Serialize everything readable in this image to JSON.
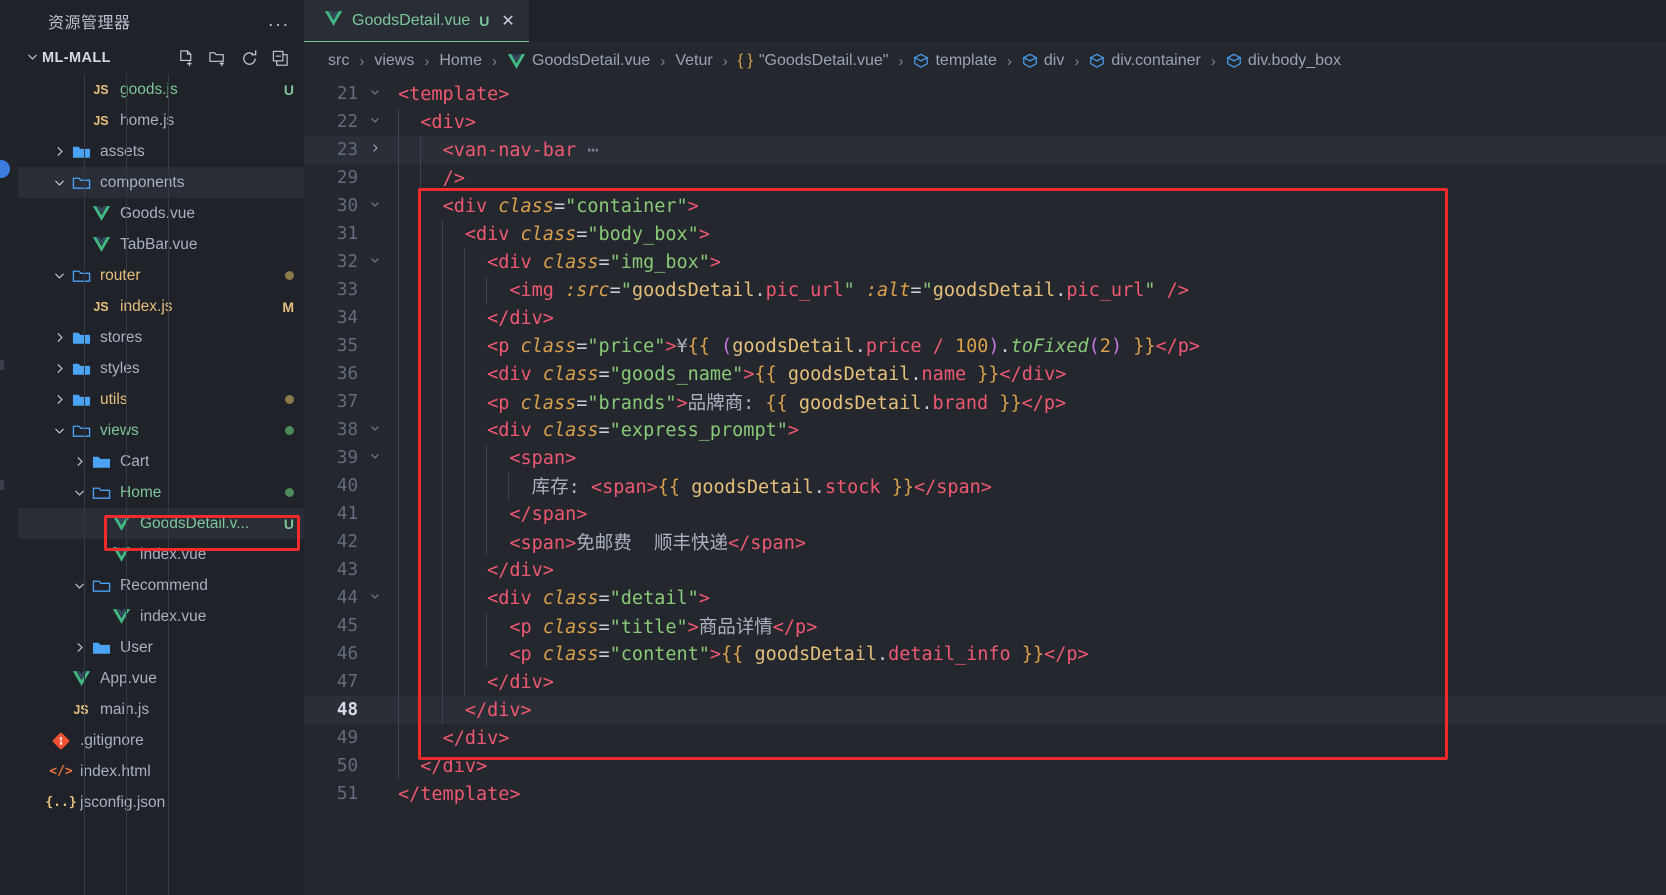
{
  "window": {
    "background": "#24272e",
    "accent_red": "#f02b2b"
  },
  "activity_bar": {
    "badge_name": "notification-badge",
    "badge_color": "#3b7ddd"
  },
  "sidebar": {
    "header_title": "资源管理器",
    "more_actions_label": "...",
    "root": {
      "label": "ML-MALL",
      "expanded": true,
      "actions": [
        {
          "name": "new-file-icon",
          "label": "New File"
        },
        {
          "name": "new-folder-icon",
          "label": "New Folder"
        },
        {
          "name": "refresh-icon",
          "label": "Refresh Explorer"
        },
        {
          "name": "collapse-all-icon",
          "label": "Collapse Folders in Explorer"
        }
      ]
    },
    "items": [
      {
        "label": "goods.js",
        "kind": "js",
        "depth": 3,
        "badge": "U",
        "badge_color": "#7ec699",
        "name_color": "#7ec699",
        "selected": false
      },
      {
        "label": "home.js",
        "kind": "js",
        "depth": 3,
        "badge": "",
        "name_color": "#a8b1c0",
        "selected": false
      },
      {
        "label": "assets",
        "kind": "folder",
        "depth": 2,
        "expanded": false,
        "name_color": "#a8b1c0",
        "selected": false
      },
      {
        "label": "components",
        "kind": "folder",
        "depth": 2,
        "expanded": true,
        "name_color": "#a8b1c0",
        "selected": true
      },
      {
        "label": "Goods.vue",
        "kind": "vue",
        "depth": 3,
        "name_color": "#a8b1c0",
        "selected": false
      },
      {
        "label": "TabBar.vue",
        "kind": "vue",
        "depth": 3,
        "name_color": "#a8b1c0",
        "selected": false
      },
      {
        "label": "router",
        "kind": "folder",
        "depth": 2,
        "expanded": true,
        "name_color": "#e8c07d",
        "dot": "#8a7a4d",
        "selected": false
      },
      {
        "label": "index.js",
        "kind": "js",
        "depth": 3,
        "badge": "M",
        "badge_color": "#e8c07d",
        "name_color": "#e8c07d",
        "selected": false
      },
      {
        "label": "stores",
        "kind": "folder",
        "depth": 2,
        "expanded": false,
        "name_color": "#a8b1c0",
        "selected": false
      },
      {
        "label": "styles",
        "kind": "folder",
        "depth": 2,
        "expanded": false,
        "name_color": "#a8b1c0",
        "selected": false
      },
      {
        "label": "utils",
        "kind": "folder",
        "depth": 2,
        "expanded": false,
        "name_color": "#e8c07d",
        "dot": "#8a7a4d",
        "selected": false
      },
      {
        "label": "views",
        "kind": "folder",
        "depth": 2,
        "expanded": true,
        "name_color": "#7ec699",
        "dot": "#4b8a5a",
        "selected": false
      },
      {
        "label": "Cart",
        "kind": "folder",
        "depth": 3,
        "expanded": false,
        "name_color": "#a8b1c0",
        "selected": false
      },
      {
        "label": "Home",
        "kind": "folder",
        "depth": 3,
        "expanded": true,
        "name_color": "#7ec699",
        "dot": "#4b8a5a",
        "selected": false
      },
      {
        "label": "GoodsDetail.v...",
        "kind": "vue",
        "depth": 4,
        "badge": "U",
        "badge_color": "#7ec699",
        "name_color": "#7ec699",
        "selected": true,
        "annotated": true
      },
      {
        "label": "index.vue",
        "kind": "vue",
        "depth": 4,
        "name_color": "#a8b1c0",
        "selected": false
      },
      {
        "label": "Recommend",
        "kind": "folder",
        "depth": 3,
        "expanded": true,
        "name_color": "#a8b1c0",
        "selected": false
      },
      {
        "label": "index.vue",
        "kind": "vue",
        "depth": 4,
        "name_color": "#a8b1c0",
        "selected": false
      },
      {
        "label": "User",
        "kind": "folder",
        "depth": 3,
        "expanded": false,
        "name_color": "#a8b1c0",
        "selected": false
      },
      {
        "label": "App.vue",
        "kind": "vue",
        "depth": 2,
        "name_color": "#a8b1c0",
        "selected": false
      },
      {
        "label": "main.js",
        "kind": "js",
        "depth": 2,
        "name_color": "#a8b1c0",
        "selected": false
      },
      {
        "label": ".gitignore",
        "kind": "git",
        "depth": 1,
        "name_color": "#a8b1c0",
        "selected": false
      },
      {
        "label": "index.html",
        "kind": "html",
        "depth": 1,
        "name_color": "#a8b1c0",
        "selected": false
      },
      {
        "label": "jsconfig.json",
        "kind": "json",
        "depth": 1,
        "name_color": "#a8b1c0",
        "selected": false
      }
    ]
  },
  "tabs": [
    {
      "name": "GoodsDetail.vue",
      "status": "U",
      "icon": "vue-icon",
      "active": true,
      "close_label": "✕"
    }
  ],
  "breadcrumbs": [
    {
      "label": "src",
      "icon": ""
    },
    {
      "label": "views",
      "icon": ""
    },
    {
      "label": "Home",
      "icon": ""
    },
    {
      "label": "GoodsDetail.vue",
      "icon": "vue-icon"
    },
    {
      "label": "Vetur",
      "icon": ""
    },
    {
      "label": "\"GoodsDetail.vue\"",
      "icon": "braces-icon"
    },
    {
      "label": "template",
      "icon": "cube-icon"
    },
    {
      "label": "div",
      "icon": "cube-icon"
    },
    {
      "label": "div.container",
      "icon": "cube-icon"
    },
    {
      "label": "div.body_box",
      "icon": "cube-icon"
    }
  ],
  "breadcrumb_separator": "›",
  "editor": {
    "active_line": 48,
    "lines": [
      {
        "num": "21",
        "fold": "chevron-down",
        "indent": 0,
        "tokens": [
          {
            "t": "tag",
            "v": "<template>"
          }
        ]
      },
      {
        "num": "22",
        "fold": "chevron-down",
        "indent": 1,
        "tokens": [
          {
            "t": "tag",
            "v": "<div>"
          }
        ]
      },
      {
        "num": "23",
        "fold": "chevron-right",
        "indent": 2,
        "highlight": true,
        "tokens": [
          {
            "t": "tag",
            "v": "<van-nav-bar"
          },
          {
            "t": "fold",
            "v": " ⋯"
          }
        ]
      },
      {
        "num": "29",
        "fold": "",
        "indent": 2,
        "tokens": [
          {
            "t": "tag",
            "v": "/>"
          }
        ]
      },
      {
        "num": "30",
        "fold": "chevron-down",
        "indent": 2,
        "tokens": [
          {
            "t": "tag",
            "v": "<div "
          },
          {
            "t": "attr",
            "v": "class"
          },
          {
            "t": "punct",
            "v": "="
          },
          {
            "t": "str",
            "v": "\"container\""
          },
          {
            "t": "tag",
            "v": ">"
          }
        ]
      },
      {
        "num": "31",
        "fold": "",
        "indent": 3,
        "tokens": [
          {
            "t": "tag",
            "v": "<div "
          },
          {
            "t": "attr",
            "v": "class"
          },
          {
            "t": "punct",
            "v": "="
          },
          {
            "t": "str",
            "v": "\"body_box\""
          },
          {
            "t": "tag",
            "v": ">"
          }
        ]
      },
      {
        "num": "32",
        "fold": "chevron-down",
        "indent": 4,
        "tokens": [
          {
            "t": "tag",
            "v": "<div "
          },
          {
            "t": "attr",
            "v": "class"
          },
          {
            "t": "punct",
            "v": "="
          },
          {
            "t": "str",
            "v": "\"img_box\""
          },
          {
            "t": "tag",
            "v": ">"
          }
        ]
      },
      {
        "num": "33",
        "fold": "",
        "indent": 5,
        "tokens": [
          {
            "t": "tag",
            "v": "<img "
          },
          {
            "t": "attr",
            "v": ":src"
          },
          {
            "t": "punct",
            "v": "="
          },
          {
            "t": "str",
            "v": "\""
          },
          {
            "t": "var",
            "v": "goodsDetail"
          },
          {
            "t": "punct",
            "v": "."
          },
          {
            "t": "prop",
            "v": "pic_url"
          },
          {
            "t": "str",
            "v": "\""
          },
          {
            "t": "punct",
            "v": " "
          },
          {
            "t": "attr",
            "v": ":alt"
          },
          {
            "t": "punct",
            "v": "="
          },
          {
            "t": "str",
            "v": "\""
          },
          {
            "t": "var",
            "v": "goodsDetail"
          },
          {
            "t": "punct",
            "v": "."
          },
          {
            "t": "prop",
            "v": "pic_url"
          },
          {
            "t": "str",
            "v": "\""
          },
          {
            "t": "tag",
            "v": " />"
          }
        ]
      },
      {
        "num": "34",
        "fold": "",
        "indent": 4,
        "tokens": [
          {
            "t": "tag",
            "v": "</div>"
          }
        ]
      },
      {
        "num": "35",
        "fold": "",
        "indent": 4,
        "tokens": [
          {
            "t": "tag",
            "v": "<p "
          },
          {
            "t": "attr",
            "v": "class"
          },
          {
            "t": "punct",
            "v": "="
          },
          {
            "t": "str",
            "v": "\"price\""
          },
          {
            "t": "tag",
            "v": ">"
          },
          {
            "t": "text",
            "v": "¥"
          },
          {
            "t": "mus",
            "v": "{{"
          },
          {
            "t": "punct",
            "v": " "
          },
          {
            "t": "paren",
            "v": "("
          },
          {
            "t": "var",
            "v": "goodsDetail"
          },
          {
            "t": "punct",
            "v": "."
          },
          {
            "t": "prop",
            "v": "price"
          },
          {
            "t": "punct",
            "v": " "
          },
          {
            "t": "op",
            "v": "/"
          },
          {
            "t": "punct",
            "v": " "
          },
          {
            "t": "num",
            "v": "100"
          },
          {
            "t": "paren",
            "v": ")"
          },
          {
            "t": "punct",
            "v": "."
          },
          {
            "t": "fn",
            "v": "toFixed"
          },
          {
            "t": "paren",
            "v": "("
          },
          {
            "t": "num",
            "v": "2"
          },
          {
            "t": "paren",
            "v": ")"
          },
          {
            "t": "punct",
            "v": " "
          },
          {
            "t": "mus",
            "v": "}}"
          },
          {
            "t": "tag",
            "v": "</p>"
          }
        ]
      },
      {
        "num": "36",
        "fold": "",
        "indent": 4,
        "tokens": [
          {
            "t": "tag",
            "v": "<div "
          },
          {
            "t": "attr",
            "v": "class"
          },
          {
            "t": "punct",
            "v": "="
          },
          {
            "t": "str",
            "v": "\"goods_name\""
          },
          {
            "t": "tag",
            "v": ">"
          },
          {
            "t": "mus",
            "v": "{{"
          },
          {
            "t": "punct",
            "v": " "
          },
          {
            "t": "var",
            "v": "goodsDetail"
          },
          {
            "t": "punct",
            "v": "."
          },
          {
            "t": "prop",
            "v": "name"
          },
          {
            "t": "punct",
            "v": " "
          },
          {
            "t": "mus",
            "v": "}}"
          },
          {
            "t": "tag",
            "v": "</div>"
          }
        ]
      },
      {
        "num": "37",
        "fold": "",
        "indent": 4,
        "tokens": [
          {
            "t": "tag",
            "v": "<p "
          },
          {
            "t": "attr",
            "v": "class"
          },
          {
            "t": "punct",
            "v": "="
          },
          {
            "t": "str",
            "v": "\"brands\""
          },
          {
            "t": "tag",
            "v": ">"
          },
          {
            "t": "text",
            "v": "品牌商: "
          },
          {
            "t": "mus",
            "v": "{{"
          },
          {
            "t": "punct",
            "v": " "
          },
          {
            "t": "var",
            "v": "goodsDetail"
          },
          {
            "t": "punct",
            "v": "."
          },
          {
            "t": "prop",
            "v": "brand"
          },
          {
            "t": "punct",
            "v": " "
          },
          {
            "t": "mus",
            "v": "}}"
          },
          {
            "t": "tag",
            "v": "</p>"
          }
        ]
      },
      {
        "num": "38",
        "fold": "chevron-down",
        "indent": 4,
        "tokens": [
          {
            "t": "tag",
            "v": "<div "
          },
          {
            "t": "attr",
            "v": "class"
          },
          {
            "t": "punct",
            "v": "="
          },
          {
            "t": "str",
            "v": "\"express_prompt\""
          },
          {
            "t": "tag",
            "v": ">"
          }
        ]
      },
      {
        "num": "39",
        "fold": "chevron-down",
        "indent": 5,
        "tokens": [
          {
            "t": "tag",
            "v": "<span>"
          }
        ]
      },
      {
        "num": "40",
        "fold": "",
        "indent": 6,
        "tokens": [
          {
            "t": "text",
            "v": "库存: "
          },
          {
            "t": "tag",
            "v": "<span>"
          },
          {
            "t": "mus",
            "v": "{{"
          },
          {
            "t": "punct",
            "v": " "
          },
          {
            "t": "var",
            "v": "goodsDetail"
          },
          {
            "t": "punct",
            "v": "."
          },
          {
            "t": "prop",
            "v": "stock"
          },
          {
            "t": "punct",
            "v": " "
          },
          {
            "t": "mus",
            "v": "}}"
          },
          {
            "t": "tag",
            "v": "</span>"
          }
        ]
      },
      {
        "num": "41",
        "fold": "",
        "indent": 5,
        "tokens": [
          {
            "t": "tag",
            "v": "</span>"
          }
        ]
      },
      {
        "num": "42",
        "fold": "",
        "indent": 5,
        "tokens": [
          {
            "t": "tag",
            "v": "<span>"
          },
          {
            "t": "text",
            "v": "免邮费  顺丰快递"
          },
          {
            "t": "tag",
            "v": "</span>"
          }
        ]
      },
      {
        "num": "43",
        "fold": "",
        "indent": 4,
        "tokens": [
          {
            "t": "tag",
            "v": "</div>"
          }
        ]
      },
      {
        "num": "44",
        "fold": "chevron-down",
        "indent": 4,
        "tokens": [
          {
            "t": "tag",
            "v": "<div "
          },
          {
            "t": "attr",
            "v": "class"
          },
          {
            "t": "punct",
            "v": "="
          },
          {
            "t": "str",
            "v": "\"detail\""
          },
          {
            "t": "tag",
            "v": ">"
          }
        ]
      },
      {
        "num": "45",
        "fold": "",
        "indent": 5,
        "tokens": [
          {
            "t": "tag",
            "v": "<p "
          },
          {
            "t": "attr",
            "v": "class"
          },
          {
            "t": "punct",
            "v": "="
          },
          {
            "t": "str",
            "v": "\"title\""
          },
          {
            "t": "tag",
            "v": ">"
          },
          {
            "t": "text",
            "v": "商品详情"
          },
          {
            "t": "tag",
            "v": "</p>"
          }
        ]
      },
      {
        "num": "46",
        "fold": "",
        "indent": 5,
        "tokens": [
          {
            "t": "tag",
            "v": "<p "
          },
          {
            "t": "attr",
            "v": "class"
          },
          {
            "t": "punct",
            "v": "="
          },
          {
            "t": "str",
            "v": "\"content\""
          },
          {
            "t": "tag",
            "v": ">"
          },
          {
            "t": "mus",
            "v": "{{"
          },
          {
            "t": "punct",
            "v": " "
          },
          {
            "t": "var",
            "v": "goodsDetail"
          },
          {
            "t": "punct",
            "v": "."
          },
          {
            "t": "prop",
            "v": "detail_info"
          },
          {
            "t": "punct",
            "v": " "
          },
          {
            "t": "mus",
            "v": "}}"
          },
          {
            "t": "tag",
            "v": "</p>"
          }
        ]
      },
      {
        "num": "47",
        "fold": "",
        "indent": 4,
        "tokens": [
          {
            "t": "tag",
            "v": "</div>"
          }
        ]
      },
      {
        "num": "48",
        "fold": "",
        "indent": 3,
        "active": true,
        "tokens": [
          {
            "t": "tag",
            "v": "</div>"
          }
        ]
      },
      {
        "num": "49",
        "fold": "",
        "indent": 2,
        "tokens": [
          {
            "t": "tag",
            "v": "</div>"
          }
        ]
      },
      {
        "num": "50",
        "fold": "",
        "indent": 1,
        "tokens": [
          {
            "t": "tag",
            "v": "</div>"
          }
        ]
      },
      {
        "num": "51",
        "fold": "",
        "indent": 0,
        "tokens": [
          {
            "t": "tag",
            "v": "</template>"
          }
        ]
      }
    ]
  },
  "annotations": [
    {
      "name": "tree-item-highlight",
      "target": "GoodsDetail.v...",
      "color": "#f02b2b"
    },
    {
      "name": "code-block-highlight",
      "target": "div.container block (lines 30-49)",
      "color": "#f02b2b"
    }
  ]
}
